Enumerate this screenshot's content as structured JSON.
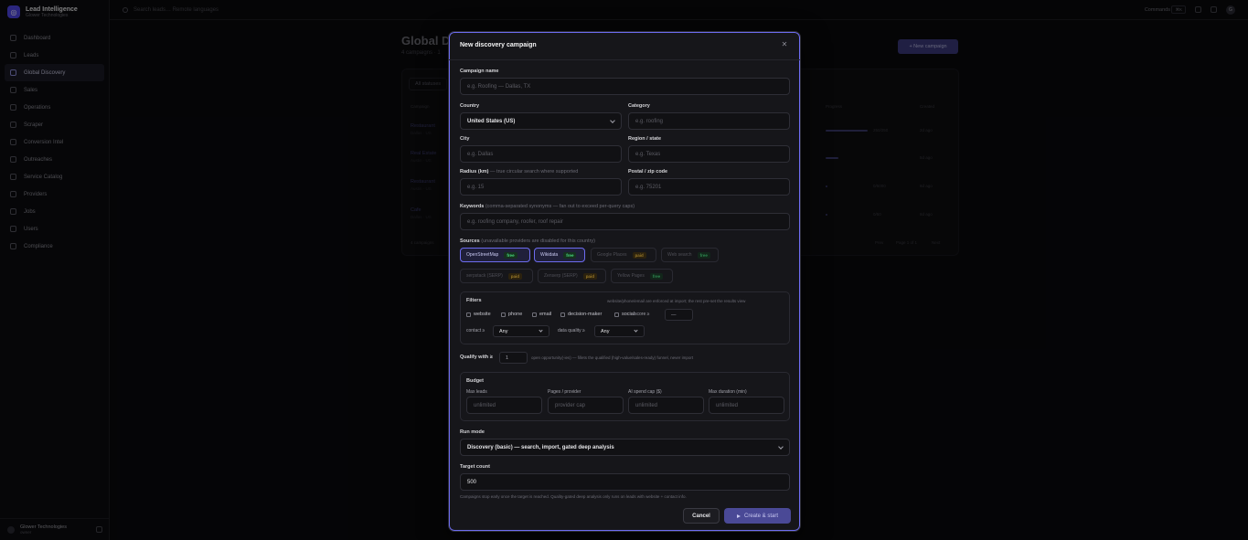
{
  "app": {
    "brand_title": "Lead Intelligence",
    "brand_sub": "Glower Technologies",
    "logo_glyph": "◎"
  },
  "sidebar": {
    "items": [
      {
        "label": "Dashboard",
        "icon": "dashboard-icon"
      },
      {
        "label": "Leads",
        "icon": "users-icon"
      },
      {
        "label": "Global Discovery",
        "icon": "globe-icon"
      },
      {
        "label": "Sales",
        "icon": "chart-icon"
      },
      {
        "label": "Operations",
        "icon": "cog-icon"
      },
      {
        "label": "Scraper",
        "icon": "scraper-icon"
      },
      {
        "label": "Conversion Intel",
        "icon": "funnel-icon"
      },
      {
        "label": "Outreaches",
        "icon": "mail-icon"
      },
      {
        "label": "Service Catalog",
        "icon": "catalog-icon"
      },
      {
        "label": "Providers",
        "icon": "plug-icon"
      },
      {
        "label": "Jobs",
        "icon": "briefcase-icon"
      },
      {
        "label": "Users",
        "icon": "user-icon"
      },
      {
        "label": "Compliance",
        "icon": "shield-icon"
      }
    ],
    "active_index": 2,
    "org_name": "Glower Technologies",
    "org_role": "owner"
  },
  "topbar": {
    "search_placeholder": "Search leads… Remote languages",
    "commands_label": "Commands",
    "commands_kbd": "⌘K",
    "avatar_initial": "G"
  },
  "background": {
    "title": "Global Di",
    "subtitle": "4 campaigns · 1",
    "new_button": "+ New campaign",
    "filter_label": "All statuses",
    "columns": {
      "name": "Campaign",
      "progress": "Progress",
      "created": "Created"
    },
    "rows": [
      {
        "name": "Restaurant",
        "sub": "Dallas · US",
        "count": "250/250",
        "age": "2d ago",
        "progress": 0.95
      },
      {
        "name": "Real Estate",
        "sub": "Austin · US",
        "count": "",
        "age": "5d ago",
        "progress": 0.3
      },
      {
        "name": "Restaurant",
        "sub": "Austin · US",
        "count": "0/5000",
        "age": "8d ago",
        "progress": 0.02
      },
      {
        "name": "Cafe",
        "sub": "Dallas · US",
        "count": "0/50",
        "age": "8d ago",
        "progress": 0.05
      }
    ],
    "footer_count": "4 campaigns",
    "footer_prev": "Prev",
    "footer_page": "Page 1 of 1",
    "footer_next": "Next"
  },
  "modal": {
    "title": "New discovery campaign",
    "campaign_name": {
      "label": "Campaign name",
      "placeholder": "e.g. Roofing — Dallas, TX"
    },
    "country": {
      "label": "Country",
      "value": "United States (US)"
    },
    "category": {
      "label": "Category",
      "placeholder": "e.g. roofing"
    },
    "city": {
      "label": "City",
      "placeholder": "e.g. Dallas"
    },
    "region": {
      "label": "Region / state",
      "placeholder": "e.g. Texas"
    },
    "radius": {
      "label": "Radius (km)",
      "hint": " — true circular search where supported",
      "placeholder": "e.g. 15"
    },
    "postal": {
      "label": "Postal / zip code",
      "placeholder": "e.g. 75201"
    },
    "keywords": {
      "label": "Keywords",
      "hint": " (comma-separated synonyms — fan out to exceed per-query caps)",
      "placeholder": "e.g. roofing company, roofer, roof repair"
    },
    "sources": {
      "label": "Sources",
      "hint": " (unavailable providers are disabled for this country)",
      "items": [
        {
          "name": "OpenStreetMap",
          "tag": "free",
          "enabled": true
        },
        {
          "name": "Wikidata",
          "tag": "free",
          "enabled": true
        },
        {
          "name": "Google Places",
          "tag": "paid",
          "enabled": false
        },
        {
          "name": "Web search",
          "tag": "free",
          "enabled": false
        },
        {
          "name": "serpstack (SERP)",
          "tag": "paid",
          "enabled": false
        },
        {
          "name": "Zenserp (SERP)",
          "tag": "paid",
          "enabled": false
        },
        {
          "name": "Yellow Pages",
          "tag": "free",
          "enabled": false
        }
      ]
    },
    "filters": {
      "title": "Filters",
      "note": "website/phone/email are enforced at import; the rest pre-set the results view",
      "checks": [
        "website",
        "phone",
        "email",
        "decision-maker",
        "social"
      ],
      "score_label": "score ≥",
      "score_placeholder": "—",
      "contact_label": "contact ≥",
      "contact_value": "Any",
      "quality_label": "data quality ≥",
      "quality_value": "Any"
    },
    "qualify": {
      "label": "Qualify with ≥",
      "value": "1",
      "hint": "open opportunity(-ies) — fillets the qualified (high-value/sales-ready) funnel, never import"
    },
    "budget": {
      "title": "Budget",
      "fields": [
        {
          "label": "Max leads",
          "placeholder": "unlimited"
        },
        {
          "label": "Pages / provider",
          "placeholder": "provider cap"
        },
        {
          "label": "AI spend cap ($)",
          "placeholder": "unlimited"
        },
        {
          "label": "Max duration (min)",
          "placeholder": "unlimited"
        }
      ]
    },
    "run_mode": {
      "label": "Run mode",
      "value": "Discovery (basic) — search, import, gated deep analysis"
    },
    "target_count": {
      "label": "Target count",
      "value": "500"
    },
    "footer_note": "Campaigns stop early once the target is reached. Quality-gated deep analysis only runs on leads with website + contact info.",
    "cancel_label": "Cancel",
    "create_label": "Create & start"
  }
}
